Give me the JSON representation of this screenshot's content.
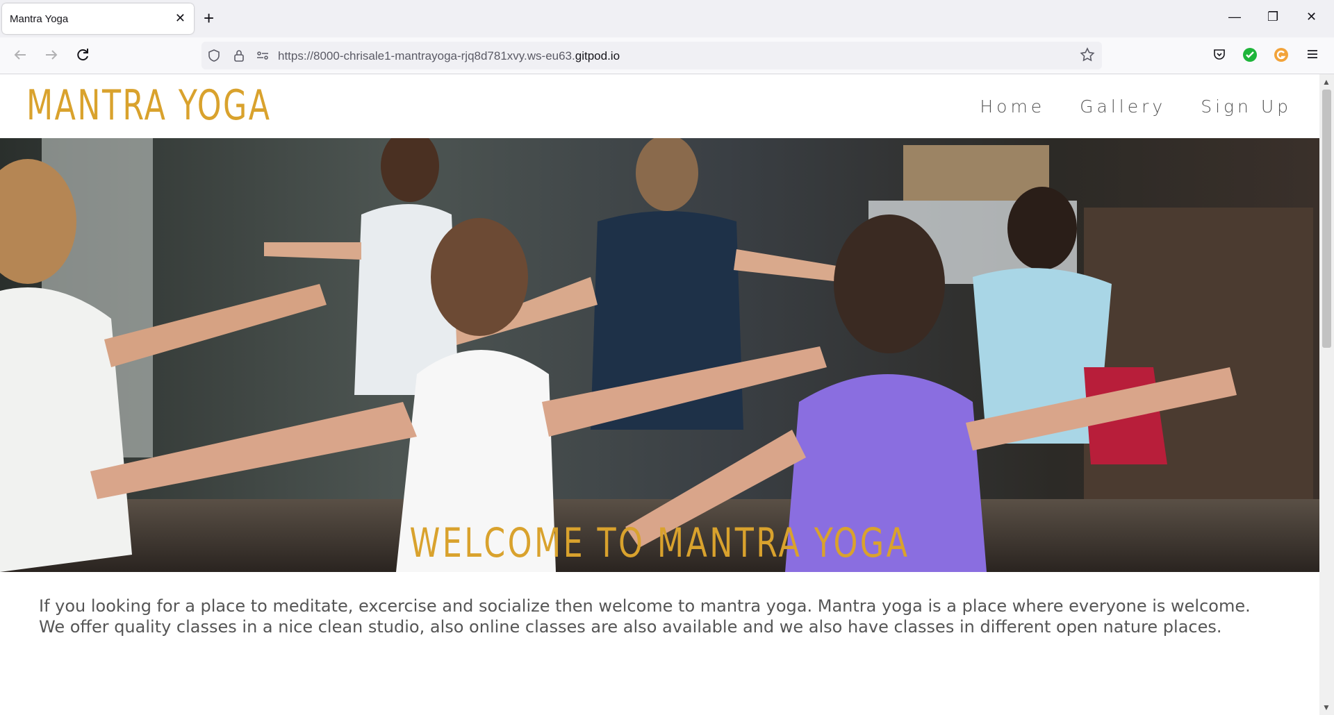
{
  "browser": {
    "tab_title": "Mantra Yoga",
    "tab_close": "✕",
    "new_tab": "+",
    "url_prefix": "https://8000-chrisale1-mantrayoga-rjq8d781xvy.ws-eu63.",
    "url_domain": "gitpod.io",
    "icons": [
      "back-arrow-icon",
      "forward-arrow-icon",
      "reload-icon",
      "shield-icon",
      "lock-icon",
      "permissions-icon",
      "star-icon",
      "pocket-icon",
      "extension-check-icon",
      "extension-g-icon",
      "hamburger-menu-icon"
    ],
    "win_min": "—",
    "win_restore": "❐",
    "win_close": "✕"
  },
  "site": {
    "logo": "MANTRA YOGA",
    "nav": [
      "Home",
      "Gallery",
      "Sign Up"
    ],
    "welcome": "WELCOME TO MANTRA YOGA",
    "intro_line1": "If you looking for a place to meditate, excercise and socialize then welcome to mantra yoga. Mantra yoga is a place where everyone is welcome.",
    "intro_line2": "We offer quality classes in a nice clean studio, also online classes are also available and we also have classes in different open nature places."
  },
  "colors": {
    "brand": "#d9a22d",
    "text": "#555555"
  }
}
